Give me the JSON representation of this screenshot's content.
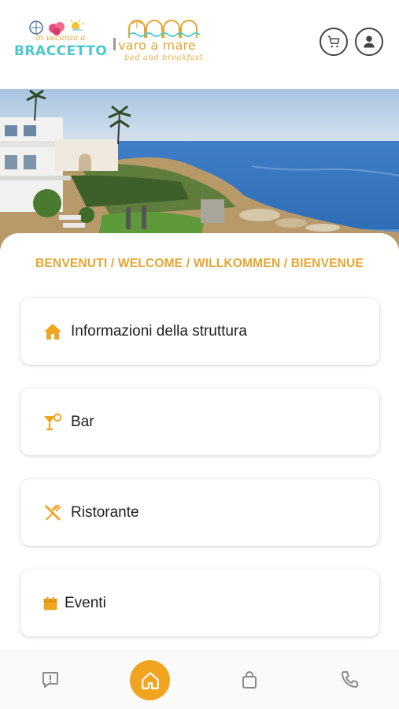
{
  "header": {
    "logo_left": {
      "tagline": "in vacanza a",
      "name": "BRACCETTO"
    },
    "logo_right": {
      "name": "varo a mare",
      "subtitle": "bed and breakfast"
    },
    "cart_icon": "cart-icon",
    "account_icon": "user-icon"
  },
  "hero": {
    "image": "seaside-villa-photo"
  },
  "welcome": "BENVENUTI / WELCOME / WILLKOMMEN / BIENVENUE",
  "menu": [
    {
      "label": "Informazioni della struttura",
      "icon": "home-icon"
    },
    {
      "label": "Bar",
      "icon": "cocktail-icon"
    },
    {
      "label": "Ristorante",
      "icon": "utensils-icon"
    },
    {
      "label": "Eventi",
      "icon": "calendar-icon"
    }
  ],
  "bottom_nav": [
    {
      "name": "feedback",
      "icon": "message-alert-icon"
    },
    {
      "name": "home",
      "icon": "home-icon",
      "active": true
    },
    {
      "name": "shop",
      "icon": "bag-icon"
    },
    {
      "name": "call",
      "icon": "phone-icon"
    }
  ],
  "colors": {
    "accent": "#f0a41f",
    "brand_teal": "#4cc7cd",
    "text": "#1e1e1e"
  }
}
